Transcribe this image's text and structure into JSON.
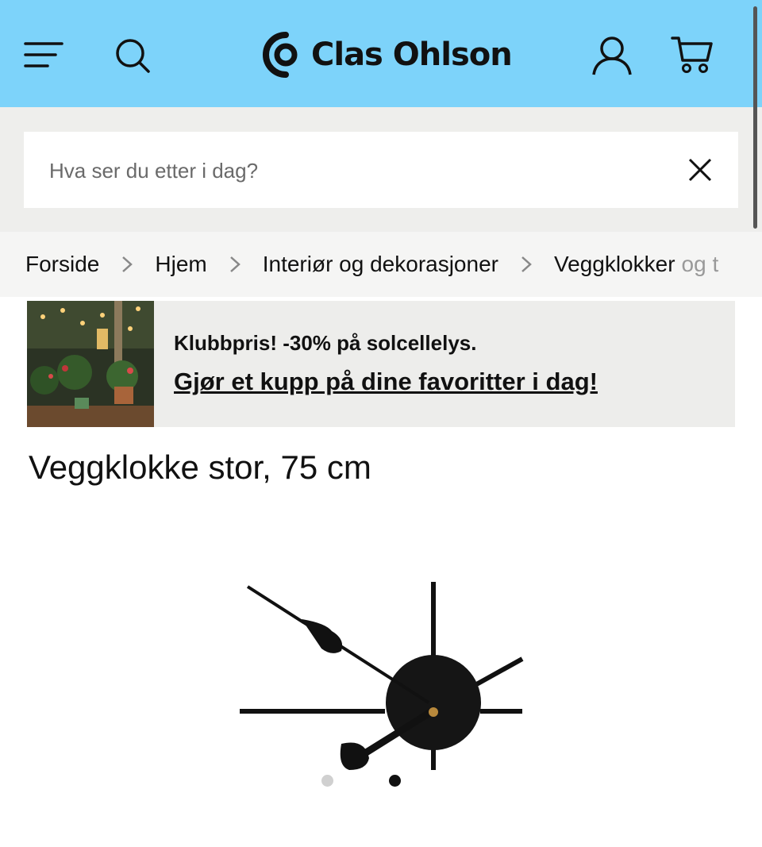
{
  "header": {
    "brand": "Clas Ohlson",
    "icons": [
      "menu-icon",
      "search-icon",
      "account-icon",
      "cart-icon"
    ],
    "color": "#7dd3fa"
  },
  "search": {
    "placeholder": "Hva ser du etter i dag?",
    "value": ""
  },
  "breadcrumb": {
    "items": [
      "Forside",
      "Hjem",
      "Interiør og dekorasjoner",
      "Veggklokker"
    ],
    "overflow_text": "og t"
  },
  "promo": {
    "title": "Klubbpris! -30% på solcellelys.",
    "link": "Gjør et kupp på dine favoritter i dag!"
  },
  "product": {
    "title": "Veggklokke stor, 75 cm"
  },
  "carousel": {
    "total": 2,
    "active": 2
  }
}
